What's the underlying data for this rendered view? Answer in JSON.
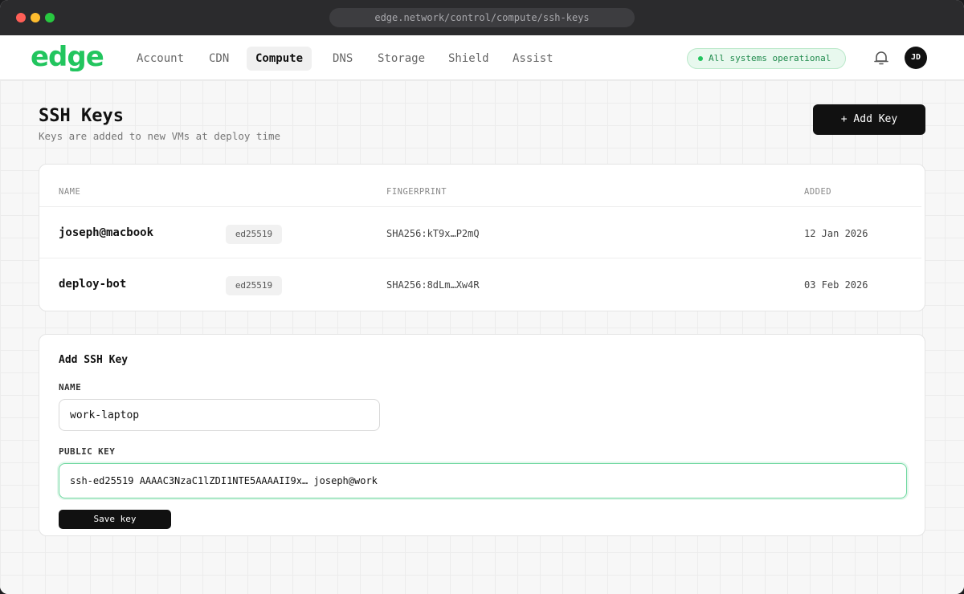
{
  "browser": {
    "url": "edge.network/control/compute/ssh-keys"
  },
  "brand": {
    "name": "edge",
    "accent": "#22c55e"
  },
  "nav": {
    "tabs": [
      {
        "label": "Account"
      },
      {
        "label": "CDN"
      },
      {
        "label": "Compute"
      },
      {
        "label": "DNS"
      },
      {
        "label": "Storage"
      },
      {
        "label": "Shield"
      },
      {
        "label": "Assist"
      }
    ],
    "active": "Compute",
    "status": "All systems operational",
    "bell_icon": "bell-icon",
    "avatar_initials": "JD"
  },
  "page": {
    "title": "SSH Keys",
    "subtitle": "Keys are added to new VMs at deploy time",
    "add_button": "+ Add Key"
  },
  "keys_table": {
    "columns": [
      "NAME",
      "FINGERPRINT",
      "ADDED"
    ],
    "rows": [
      {
        "name": "joseph@macbook",
        "type": "ed25519",
        "fingerprint": "SHA256:kT9x…P2mQ",
        "added": "12 Jan 2026"
      },
      {
        "name": "deploy-bot",
        "type": "ed25519",
        "fingerprint": "SHA256:8dLm…Xw4R",
        "added": "03 Feb 2026"
      }
    ]
  },
  "add_form": {
    "title": "Add SSH Key",
    "name_label": "NAME",
    "name_value": "work-laptop",
    "key_label": "PUBLIC KEY",
    "key_value": "ssh-ed25519 AAAAC3NzaC1lZDI1NTE5AAAAII9x… joseph@work",
    "save_button": "Save key"
  }
}
